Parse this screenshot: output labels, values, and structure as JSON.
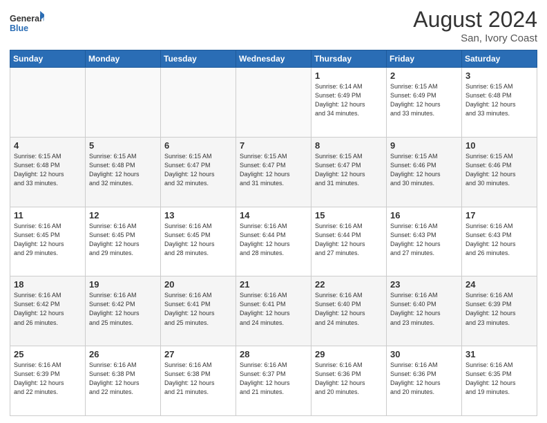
{
  "header": {
    "logo_line1": "General",
    "logo_line2": "Blue",
    "month_year": "August 2024",
    "location": "San, Ivory Coast"
  },
  "days_of_week": [
    "Sunday",
    "Monday",
    "Tuesday",
    "Wednesday",
    "Thursday",
    "Friday",
    "Saturday"
  ],
  "weeks": [
    [
      {
        "day": "",
        "info": ""
      },
      {
        "day": "",
        "info": ""
      },
      {
        "day": "",
        "info": ""
      },
      {
        "day": "",
        "info": ""
      },
      {
        "day": "1",
        "info": "Sunrise: 6:14 AM\nSunset: 6:49 PM\nDaylight: 12 hours\nand 34 minutes."
      },
      {
        "day": "2",
        "info": "Sunrise: 6:15 AM\nSunset: 6:49 PM\nDaylight: 12 hours\nand 33 minutes."
      },
      {
        "day": "3",
        "info": "Sunrise: 6:15 AM\nSunset: 6:48 PM\nDaylight: 12 hours\nand 33 minutes."
      }
    ],
    [
      {
        "day": "4",
        "info": "Sunrise: 6:15 AM\nSunset: 6:48 PM\nDaylight: 12 hours\nand 33 minutes."
      },
      {
        "day": "5",
        "info": "Sunrise: 6:15 AM\nSunset: 6:48 PM\nDaylight: 12 hours\nand 32 minutes."
      },
      {
        "day": "6",
        "info": "Sunrise: 6:15 AM\nSunset: 6:47 PM\nDaylight: 12 hours\nand 32 minutes."
      },
      {
        "day": "7",
        "info": "Sunrise: 6:15 AM\nSunset: 6:47 PM\nDaylight: 12 hours\nand 31 minutes."
      },
      {
        "day": "8",
        "info": "Sunrise: 6:15 AM\nSunset: 6:47 PM\nDaylight: 12 hours\nand 31 minutes."
      },
      {
        "day": "9",
        "info": "Sunrise: 6:15 AM\nSunset: 6:46 PM\nDaylight: 12 hours\nand 30 minutes."
      },
      {
        "day": "10",
        "info": "Sunrise: 6:15 AM\nSunset: 6:46 PM\nDaylight: 12 hours\nand 30 minutes."
      }
    ],
    [
      {
        "day": "11",
        "info": "Sunrise: 6:16 AM\nSunset: 6:45 PM\nDaylight: 12 hours\nand 29 minutes."
      },
      {
        "day": "12",
        "info": "Sunrise: 6:16 AM\nSunset: 6:45 PM\nDaylight: 12 hours\nand 29 minutes."
      },
      {
        "day": "13",
        "info": "Sunrise: 6:16 AM\nSunset: 6:45 PM\nDaylight: 12 hours\nand 28 minutes."
      },
      {
        "day": "14",
        "info": "Sunrise: 6:16 AM\nSunset: 6:44 PM\nDaylight: 12 hours\nand 28 minutes."
      },
      {
        "day": "15",
        "info": "Sunrise: 6:16 AM\nSunset: 6:44 PM\nDaylight: 12 hours\nand 27 minutes."
      },
      {
        "day": "16",
        "info": "Sunrise: 6:16 AM\nSunset: 6:43 PM\nDaylight: 12 hours\nand 27 minutes."
      },
      {
        "day": "17",
        "info": "Sunrise: 6:16 AM\nSunset: 6:43 PM\nDaylight: 12 hours\nand 26 minutes."
      }
    ],
    [
      {
        "day": "18",
        "info": "Sunrise: 6:16 AM\nSunset: 6:42 PM\nDaylight: 12 hours\nand 26 minutes."
      },
      {
        "day": "19",
        "info": "Sunrise: 6:16 AM\nSunset: 6:42 PM\nDaylight: 12 hours\nand 25 minutes."
      },
      {
        "day": "20",
        "info": "Sunrise: 6:16 AM\nSunset: 6:41 PM\nDaylight: 12 hours\nand 25 minutes."
      },
      {
        "day": "21",
        "info": "Sunrise: 6:16 AM\nSunset: 6:41 PM\nDaylight: 12 hours\nand 24 minutes."
      },
      {
        "day": "22",
        "info": "Sunrise: 6:16 AM\nSunset: 6:40 PM\nDaylight: 12 hours\nand 24 minutes."
      },
      {
        "day": "23",
        "info": "Sunrise: 6:16 AM\nSunset: 6:40 PM\nDaylight: 12 hours\nand 23 minutes."
      },
      {
        "day": "24",
        "info": "Sunrise: 6:16 AM\nSunset: 6:39 PM\nDaylight: 12 hours\nand 23 minutes."
      }
    ],
    [
      {
        "day": "25",
        "info": "Sunrise: 6:16 AM\nSunset: 6:39 PM\nDaylight: 12 hours\nand 22 minutes."
      },
      {
        "day": "26",
        "info": "Sunrise: 6:16 AM\nSunset: 6:38 PM\nDaylight: 12 hours\nand 22 minutes."
      },
      {
        "day": "27",
        "info": "Sunrise: 6:16 AM\nSunset: 6:38 PM\nDaylight: 12 hours\nand 21 minutes."
      },
      {
        "day": "28",
        "info": "Sunrise: 6:16 AM\nSunset: 6:37 PM\nDaylight: 12 hours\nand 21 minutes."
      },
      {
        "day": "29",
        "info": "Sunrise: 6:16 AM\nSunset: 6:36 PM\nDaylight: 12 hours\nand 20 minutes."
      },
      {
        "day": "30",
        "info": "Sunrise: 6:16 AM\nSunset: 6:36 PM\nDaylight: 12 hours\nand 20 minutes."
      },
      {
        "day": "31",
        "info": "Sunrise: 6:16 AM\nSunset: 6:35 PM\nDaylight: 12 hours\nand 19 minutes."
      }
    ]
  ]
}
